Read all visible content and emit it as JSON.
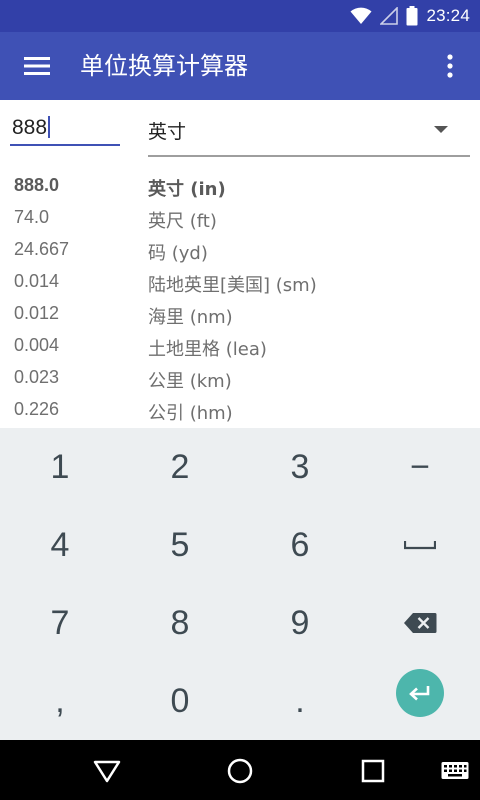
{
  "status_bar": {
    "time": "23:24",
    "icons": [
      "wifi-icon",
      "signal-icon",
      "battery-icon"
    ]
  },
  "app_bar": {
    "title": "单位换算计算器",
    "icons": [
      "menu-icon",
      "more-vert-icon"
    ]
  },
  "input": {
    "value": "888",
    "unit": "英寸"
  },
  "results": [
    {
      "value": "888.0",
      "unit": "英寸 (in)",
      "active": true
    },
    {
      "value": "74.0",
      "unit": "英尺 (ft)"
    },
    {
      "value": "24.667",
      "unit": "码 (yd)"
    },
    {
      "value": "0.014",
      "unit": "陆地英里[美国] (sm)"
    },
    {
      "value": "0.012",
      "unit": "海里 (nm)"
    },
    {
      "value": "0.004",
      "unit": "土地里格 (lea)"
    },
    {
      "value": "0.023",
      "unit": "公里 (km)"
    },
    {
      "value": "0.226",
      "unit": "公引 (hm)"
    }
  ],
  "keypad": {
    "keys": [
      "1",
      "2",
      "3",
      "−",
      "4",
      "5",
      "6",
      "",
      "7",
      "8",
      "9",
      "",
      ",",
      "0",
      ".",
      ""
    ],
    "icons": [
      "space-icon",
      "backspace-icon",
      "enter-icon"
    ]
  },
  "nav_bar": {
    "icons": [
      "back-icon",
      "home-icon",
      "recents-icon",
      "keyboard-icon"
    ]
  },
  "colors": {
    "status_bar": "#3240a8",
    "app_bar": "#3f51b5",
    "accent": "#4db6ac",
    "keypad_bg": "#eceff1"
  }
}
